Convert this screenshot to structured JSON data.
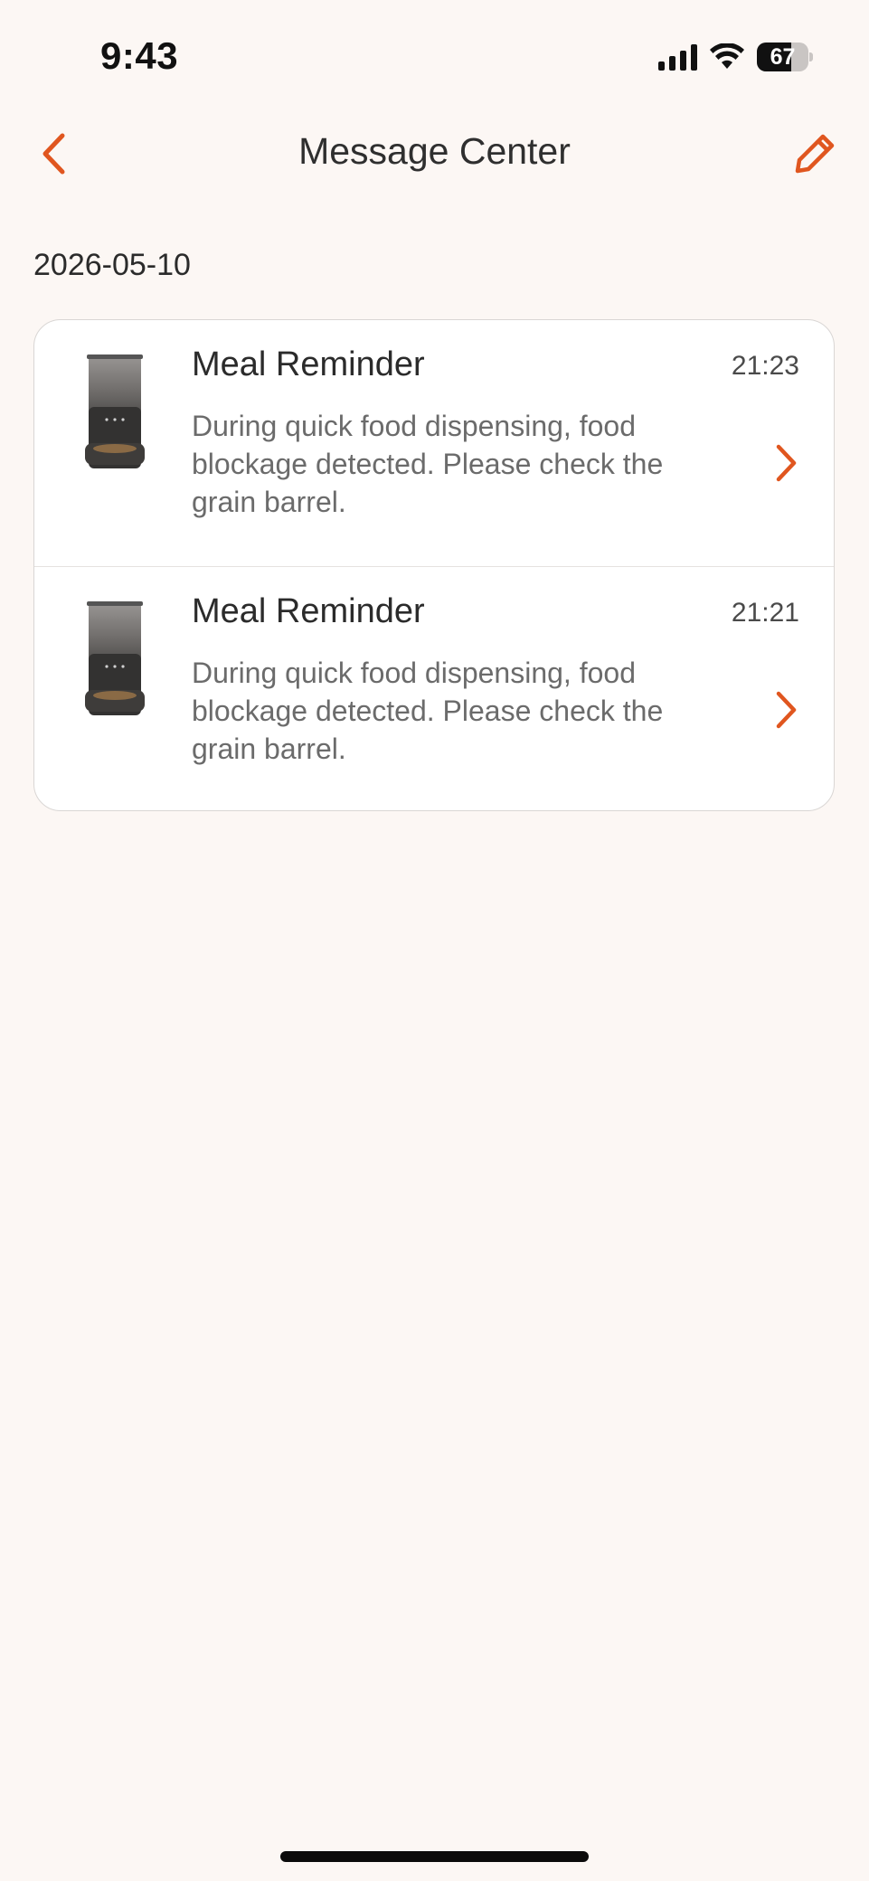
{
  "status_bar": {
    "time": "9:43",
    "battery": "67",
    "battery_level": 0.67
  },
  "nav": {
    "title": "Message Center"
  },
  "groups": [
    {
      "date": "2026-05-10",
      "messages": [
        {
          "title": "Meal Reminder",
          "time": "21:23",
          "body": "During quick food dispensing, food blockage detected. Please check the grain barrel."
        },
        {
          "title": "Meal Reminder",
          "time": "21:21",
          "body": "During quick food dispensing, food blockage detected. Please check the grain barrel."
        }
      ]
    }
  ],
  "colors": {
    "accent": "#E0561F",
    "background": "#FCF7F4",
    "card": "#FFFFFF"
  }
}
